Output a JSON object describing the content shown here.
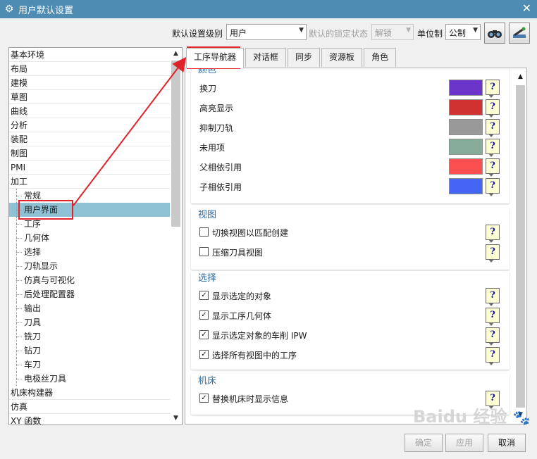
{
  "window": {
    "title": "用户默认设置",
    "close_glyph": "✕"
  },
  "toolbar": {
    "level_label": "默认设置级别",
    "level_value": "用户",
    "lock_label": "默认的锁定状态",
    "lock_value": "解锁",
    "unit_label": "单位制",
    "unit_value": "公制"
  },
  "tree": {
    "items": [
      {
        "label": "基本环境",
        "child": false
      },
      {
        "label": "布局",
        "child": false
      },
      {
        "label": "建模",
        "child": false
      },
      {
        "label": "草图",
        "child": false
      },
      {
        "label": "曲线",
        "child": false
      },
      {
        "label": "分析",
        "child": false
      },
      {
        "label": "装配",
        "child": false
      },
      {
        "label": "制图",
        "child": false
      },
      {
        "label": "PMI",
        "child": false
      },
      {
        "label": "加工",
        "child": false
      },
      {
        "label": "常规",
        "child": true
      },
      {
        "label": "用户界面",
        "child": true,
        "selected": true
      },
      {
        "label": "工序",
        "child": true
      },
      {
        "label": "几何体",
        "child": true
      },
      {
        "label": "选择",
        "child": true
      },
      {
        "label": "刀轨显示",
        "child": true
      },
      {
        "label": "仿真与可视化",
        "child": true
      },
      {
        "label": "后处理配置器",
        "child": true
      },
      {
        "label": "输出",
        "child": true
      },
      {
        "label": "刀具",
        "child": true
      },
      {
        "label": "铣刀",
        "child": true
      },
      {
        "label": "钻刀",
        "child": true
      },
      {
        "label": "车刀",
        "child": true
      },
      {
        "label": "电极丝刀具",
        "child": true
      },
      {
        "label": "机床构建器",
        "child": false
      },
      {
        "label": "仿真",
        "child": false
      },
      {
        "label": "XY 函数",
        "child": false
      }
    ]
  },
  "tabs": [
    {
      "label": "工序导航器",
      "active": true
    },
    {
      "label": "对话框"
    },
    {
      "label": "同步"
    },
    {
      "label": "资源板"
    },
    {
      "label": "角色"
    }
  ],
  "groups": {
    "color": {
      "title": "颜色",
      "rows": [
        {
          "label": "换刀",
          "color": "#6a35c8"
        },
        {
          "label": "高亮显示",
          "color": "#d03232"
        },
        {
          "label": "抑制刀轨",
          "color": "#999999"
        },
        {
          "label": "未用项",
          "color": "#88ac9a"
        },
        {
          "label": "父相依引用",
          "color": "#fb4e4e"
        },
        {
          "label": "子相依引用",
          "color": "#4565f5"
        }
      ]
    },
    "view": {
      "title": "视图",
      "rows": [
        {
          "label": "切换视图以匹配创建",
          "checked": false
        },
        {
          "label": "压缩刀具视图",
          "checked": false
        }
      ]
    },
    "selection": {
      "title": "选择",
      "rows": [
        {
          "label": "显示选定的对象",
          "checked": true
        },
        {
          "label": "显示工序几何体",
          "checked": true
        },
        {
          "label": "显示选定对象的车削 IPW",
          "checked": true
        },
        {
          "label": "选择所有视图中的工序",
          "checked": true
        }
      ]
    },
    "machine": {
      "title": "机床",
      "rows": [
        {
          "label": "替换机床时显示信息",
          "checked": true
        }
      ]
    }
  },
  "help_glyph": "?",
  "check_glyph": "✓",
  "footer": {
    "ok": "确定",
    "apply": "应用",
    "cancel": "取消"
  },
  "watermark": {
    "text": "Baidu 经验"
  }
}
